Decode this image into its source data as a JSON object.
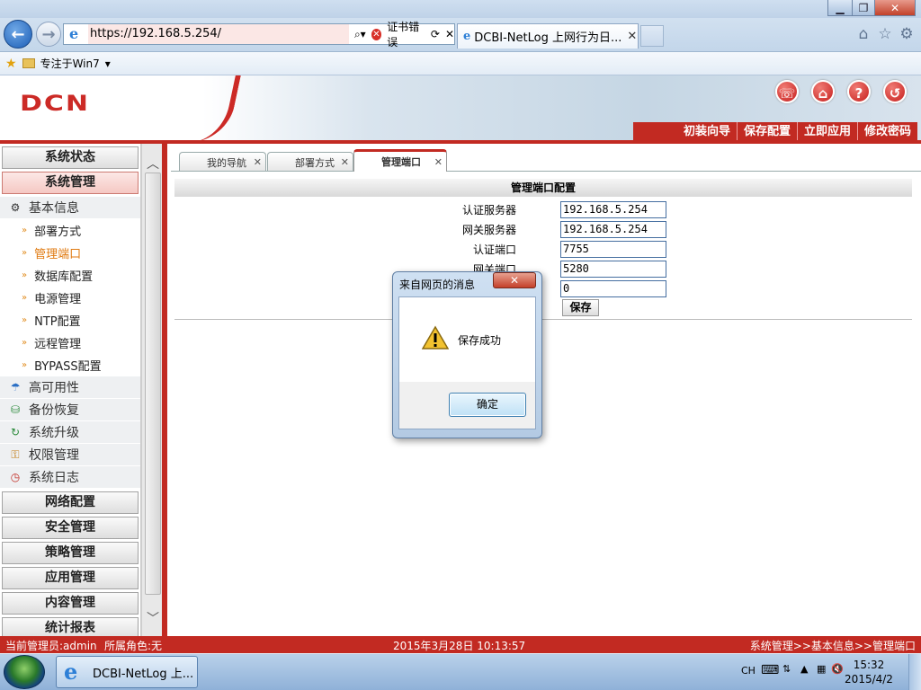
{
  "browser": {
    "url": "https://192.168.5.254/",
    "cert_error": "证书错误",
    "tab_title": "DCBI-NetLog 上网行为日...",
    "favorites_item": "专注于Win7"
  },
  "banner": {
    "logo": "DCN",
    "nav": [
      "初装向导",
      "保存配置",
      "立即应用",
      "修改密码"
    ]
  },
  "sidebar": {
    "sections_top": [
      "系统状态",
      "系统管理"
    ],
    "basic_info": "基本信息",
    "subitems": [
      "部署方式",
      "管理端口",
      "数据库配置",
      "电源管理",
      "NTP配置",
      "远程管理",
      "BYPASS配置"
    ],
    "categories": [
      {
        "label": "高可用性",
        "icon": "umbrella-icon"
      },
      {
        "label": "备份恢复",
        "icon": "backup-icon"
      },
      {
        "label": "系统升级",
        "icon": "upgrade-icon"
      },
      {
        "label": "权限管理",
        "icon": "permission-icon"
      },
      {
        "label": "系统日志",
        "icon": "log-icon"
      }
    ],
    "sections_bottom": [
      "网络配置",
      "安全管理",
      "策略管理",
      "应用管理",
      "内容管理",
      "统计报表"
    ]
  },
  "tabs": [
    "我的导航",
    "部署方式",
    "管理端口"
  ],
  "panel": {
    "title": "管理端口配置",
    "fields": [
      {
        "label": "认证服务器",
        "value": "192.168.5.254"
      },
      {
        "label": "网关服务器",
        "value": "192.168.5.254"
      },
      {
        "label": "认证端口",
        "value": "7755"
      },
      {
        "label": "网关端口",
        "value": "5280"
      },
      {
        "label": "",
        "value": "0"
      }
    ],
    "save": "保存"
  },
  "dialog": {
    "title": "来自网页的消息",
    "message": "保存成功",
    "ok": "确定"
  },
  "status": {
    "admin": "当前管理员:admin",
    "role": "所属角色:无",
    "datetime": "2015年3月28日 10:13:57",
    "breadcrumb": "系统管理>>基本信息>>管理端口"
  },
  "taskbar": {
    "item": "DCBI-NetLog 上...",
    "lang": "CH",
    "time": "15:32",
    "date": "2015/4/2"
  }
}
